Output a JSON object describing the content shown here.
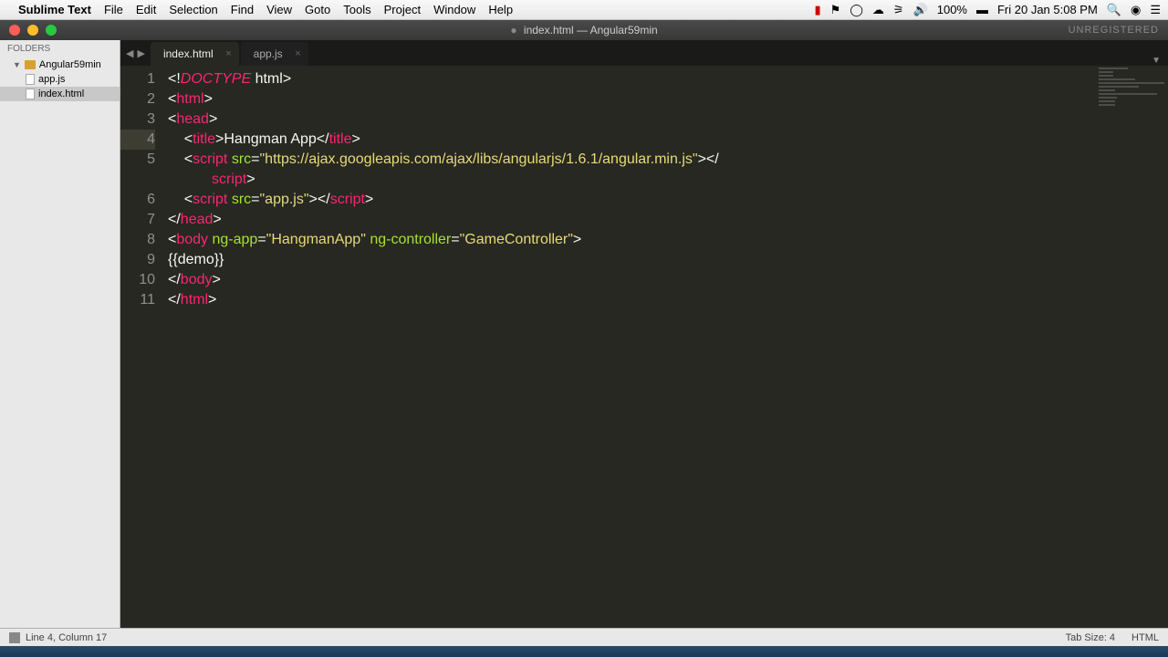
{
  "menubar": {
    "app": "Sublime Text",
    "items": [
      "File",
      "Edit",
      "Selection",
      "Find",
      "View",
      "Goto",
      "Tools",
      "Project",
      "Window",
      "Help"
    ],
    "battery": "100%",
    "clock": "Fri 20 Jan  5:08 PM"
  },
  "titlebar": {
    "title": "index.html — Angular59min",
    "unregistered": "UNREGISTERED"
  },
  "sidebar": {
    "header": "Folders",
    "project": "Angular59min",
    "files": [
      "app.js",
      "index.html"
    ],
    "active": "index.html"
  },
  "tabs": [
    {
      "name": "index.html",
      "active": true
    },
    {
      "name": "app.js",
      "active": false
    }
  ],
  "code": {
    "lines": [
      {
        "n": 1,
        "tokens": [
          [
            "punct",
            "<!"
          ],
          [
            "doctype",
            "DOCTYPE"
          ],
          [
            "text",
            " html"
          ],
          [
            "punct",
            ">"
          ]
        ]
      },
      {
        "n": 2,
        "tokens": [
          [
            "punct",
            "<"
          ],
          [
            "tag",
            "html"
          ],
          [
            "punct",
            ">"
          ]
        ]
      },
      {
        "n": 3,
        "tokens": [
          [
            "punct",
            "<"
          ],
          [
            "tag",
            "head"
          ],
          [
            "punct",
            ">"
          ]
        ]
      },
      {
        "n": 4,
        "active": true,
        "indent": 1,
        "tokens": [
          [
            "punct",
            "<"
          ],
          [
            "tag",
            "title"
          ],
          [
            "punct",
            ">"
          ],
          [
            "text",
            "Hangman App"
          ],
          [
            "punct",
            "</"
          ],
          [
            "tag",
            "title"
          ],
          [
            "punct",
            ">"
          ]
        ]
      },
      {
        "n": 5,
        "indent": 1,
        "tokens": [
          [
            "punct",
            "<"
          ],
          [
            "tag",
            "script"
          ],
          [
            "text",
            " "
          ],
          [
            "attr",
            "src"
          ],
          [
            "punct",
            "="
          ],
          [
            "str",
            "\"https://ajax.googleapis.com/ajax/libs/angularjs/1.6.1/angular.min.js\""
          ],
          [
            "punct",
            "></"
          ]
        ]
      },
      {
        "n": null,
        "wrap": true,
        "tokens": [
          [
            "tag",
            "script"
          ],
          [
            "punct",
            ">"
          ]
        ]
      },
      {
        "n": 6,
        "indent": 1,
        "tokens": [
          [
            "punct",
            "<"
          ],
          [
            "tag",
            "script"
          ],
          [
            "text",
            " "
          ],
          [
            "attr",
            "src"
          ],
          [
            "punct",
            "="
          ],
          [
            "str",
            "\"app.js\""
          ],
          [
            "punct",
            "></"
          ],
          [
            "tag",
            "script"
          ],
          [
            "punct",
            ">"
          ]
        ]
      },
      {
        "n": 7,
        "tokens": [
          [
            "punct",
            "</"
          ],
          [
            "tag",
            "head"
          ],
          [
            "punct",
            ">"
          ]
        ]
      },
      {
        "n": 8,
        "tokens": [
          [
            "punct",
            "<"
          ],
          [
            "tag",
            "body"
          ],
          [
            "text",
            " "
          ],
          [
            "attr",
            "ng-app"
          ],
          [
            "punct",
            "="
          ],
          [
            "str",
            "\"HangmanApp\""
          ],
          [
            "text",
            " "
          ],
          [
            "attr",
            "ng-controller"
          ],
          [
            "punct",
            "="
          ],
          [
            "str",
            "\"GameController\""
          ],
          [
            "punct",
            ">"
          ]
        ]
      },
      {
        "n": 9,
        "tokens": [
          [
            "text",
            "{{demo}}"
          ]
        ]
      },
      {
        "n": 10,
        "tokens": [
          [
            "punct",
            "</"
          ],
          [
            "tag",
            "body"
          ],
          [
            "punct",
            ">"
          ]
        ]
      },
      {
        "n": 11,
        "tokens": [
          [
            "punct",
            "</"
          ],
          [
            "tag",
            "html"
          ],
          [
            "punct",
            ">"
          ]
        ]
      }
    ]
  },
  "statusbar": {
    "position": "Line 4, Column 17",
    "tabsize": "Tab Size: 4",
    "syntax": "HTML"
  }
}
